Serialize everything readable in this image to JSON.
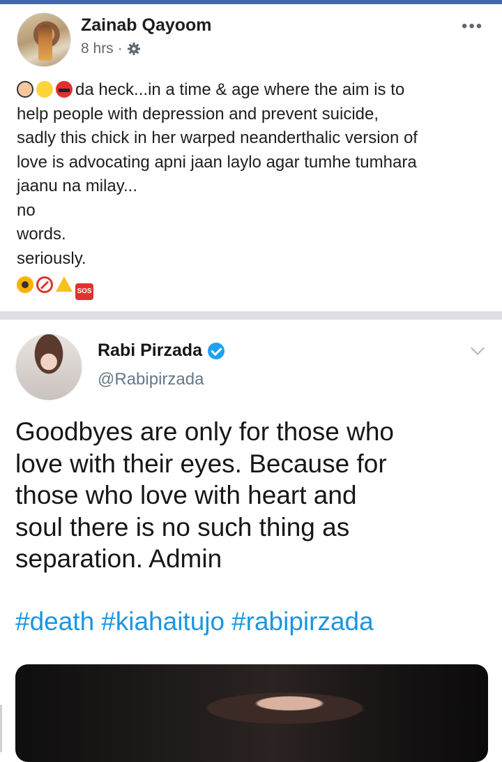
{
  "post": {
    "author": "Zainab Qayoom",
    "time": "8 hrs",
    "dot": "·",
    "more": "•••",
    "lines": [
      "da heck...in a time & age where the aim is to",
      "help people with depression and prevent suicide,",
      "sadly this chick in her warped neanderthalic version of",
      "love is advocating apni jaan laylo agar tumhe tumhara",
      "jaanu na milay...",
      "no",
      "words.",
      "seriously."
    ],
    "lead_emojis": [
      "face-palm-icon",
      "scream-icon",
      "cursing-face-icon"
    ],
    "trail_emojis": [
      "radioactive-icon",
      "no-entry-icon",
      "warning-icon",
      "sos-icon"
    ],
    "sos_label": "SOS"
  },
  "tweet": {
    "name": "Rabi Pirzada",
    "handle": "@Rabipirzada",
    "lines": [
      "Goodbyes are only for those who",
      "love with their eyes. Because for",
      "those who love with heart and",
      "soul there is no such thing as",
      "separation. Admin"
    ],
    "hashtags": [
      "#death",
      "#kiahaitujo",
      "#rabipirzada"
    ]
  },
  "colors": {
    "facebook_blue": "#4267b2",
    "twitter_blue": "#1da1f2",
    "hashtag": "#1b95e0"
  }
}
